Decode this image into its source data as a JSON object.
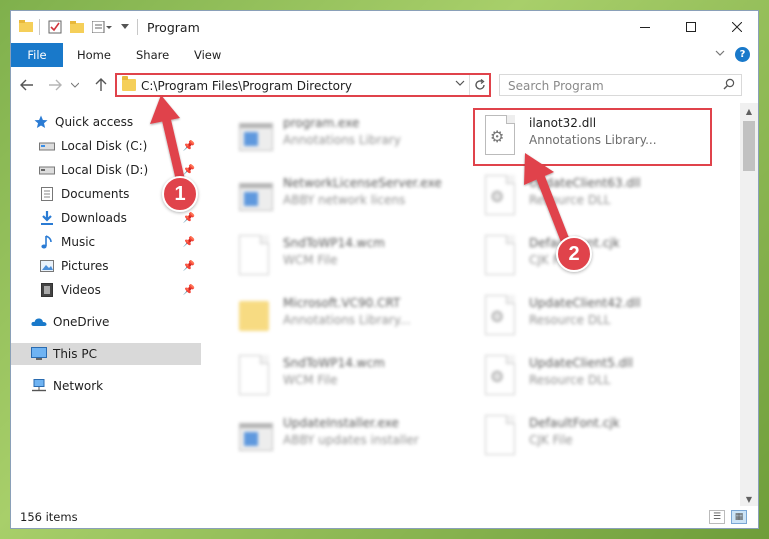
{
  "window": {
    "title": "Program"
  },
  "ribbon": {
    "file": "File",
    "home": "Home",
    "share": "Share",
    "view": "View",
    "help": "?"
  },
  "address": {
    "path": "C:\\Program Files\\Program Directory"
  },
  "search": {
    "placeholder": "Search Program"
  },
  "nav": {
    "quick_access": "Quick access",
    "local_c": "Local Disk (C:)",
    "local_d": "Local Disk (D:)",
    "documents": "Documents",
    "downloads": "Downloads",
    "music": "Music",
    "pictures": "Pictures",
    "videos": "Videos",
    "onedrive": "OneDrive",
    "this_pc": "This PC",
    "network": "Network"
  },
  "files": {
    "f1": {
      "name": "program.exe",
      "desc": "Annotations Library"
    },
    "f2": {
      "name": "ilanot32.dll",
      "desc": "Annotations Library..."
    },
    "f3": {
      "name": "NetworkLicenseServer.exe",
      "desc": "ABBY network licens"
    },
    "f4": {
      "name": "UpdateClient63.dll",
      "desc": "Resource DLL"
    },
    "f5": {
      "name": "SndToWP14.wcm",
      "desc": "WCM File"
    },
    "f6": {
      "name": "DefaultFont.cjk",
      "desc": "CJK File"
    },
    "f7": {
      "name": "Microsoft.VC90.CRT",
      "desc": "Annotations Library..."
    },
    "f8": {
      "name": "UpdateClient42.dll",
      "desc": "Resource DLL"
    },
    "f9": {
      "name": "SndToWP14.wcm",
      "desc": "WCM File"
    },
    "f10": {
      "name": "UpdateClient5.dll",
      "desc": "Resource DLL"
    },
    "f11": {
      "name": "UpdateInstaller.exe",
      "desc": "ABBY updates installer"
    },
    "f12": {
      "name": "DefaultFont.cjk",
      "desc": "CJK File"
    }
  },
  "status": {
    "count": "156 items"
  },
  "annotations": {
    "step1": "1",
    "step2": "2",
    "accent": "#e0434b"
  },
  "icons": [
    "folder-icon",
    "checkbox-icon",
    "properties-icon",
    "back-icon",
    "forward-icon",
    "up-icon",
    "refresh-icon",
    "search-icon",
    "star-icon",
    "disk-icon",
    "documents-icon",
    "downloads-icon",
    "music-icon",
    "pictures-icon",
    "videos-icon",
    "onedrive-icon",
    "pc-icon",
    "network-icon",
    "gear-icon",
    "pin-icon"
  ]
}
